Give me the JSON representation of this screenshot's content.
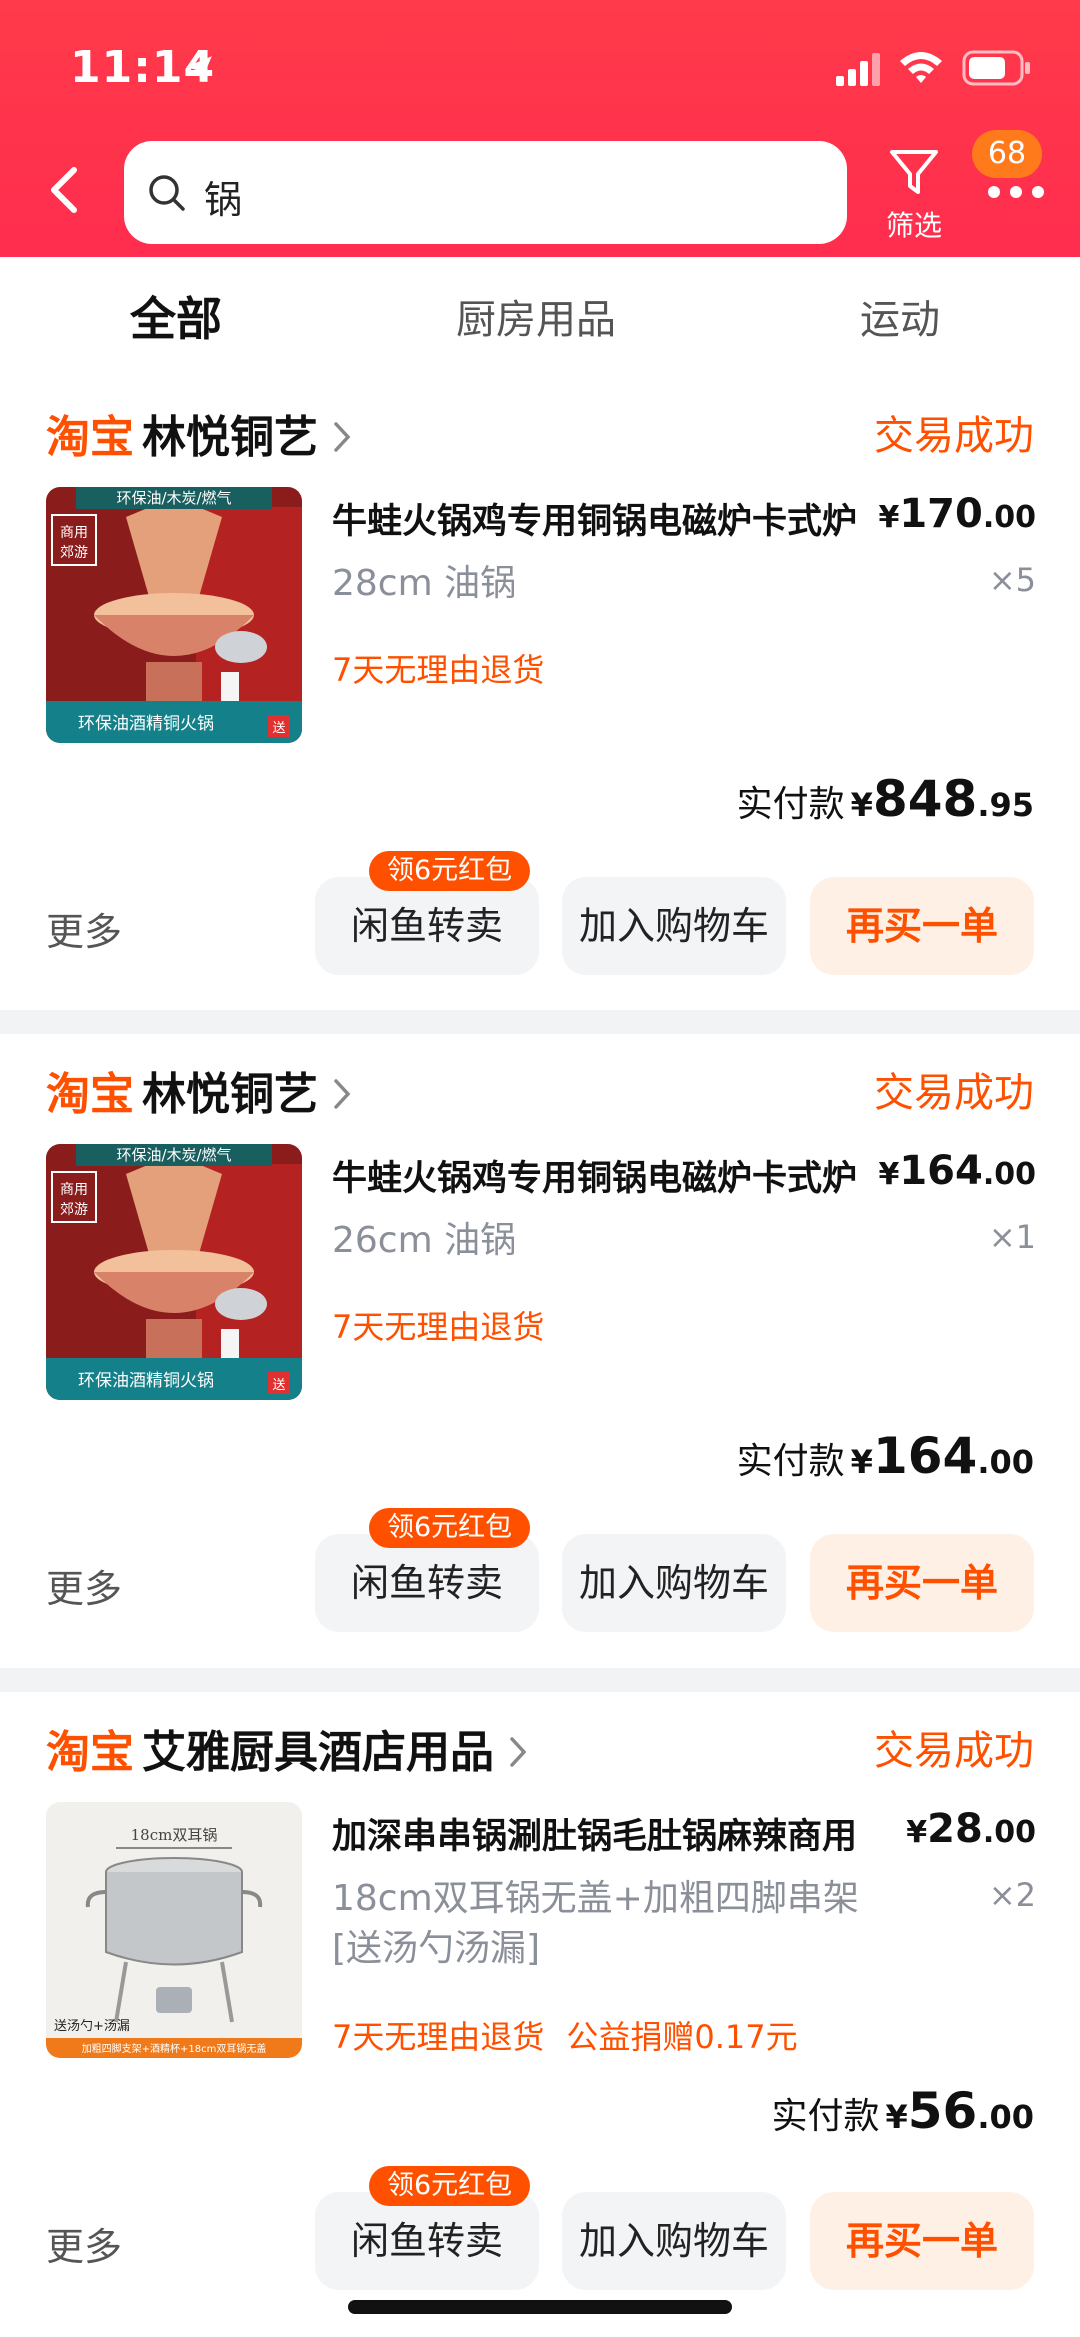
{
  "status_bar": {
    "time": "11:14"
  },
  "search": {
    "query": "锅"
  },
  "header": {
    "filter_label": "筛选",
    "more_badge": "68"
  },
  "tabs": [
    {
      "label": "全部",
      "active": true
    },
    {
      "label": "厨房用品",
      "active": false
    },
    {
      "label": "运动",
      "active": false
    }
  ],
  "orders": [
    {
      "platform": "淘宝",
      "shop": "林悦铜艺",
      "status": "交易成功",
      "title": "牛蛙火锅鸡专用铜锅电磁炉卡式炉",
      "price_yen": "¥",
      "price_int": "170",
      "price_dec": ".00",
      "sku": "28cm 油锅",
      "sku2": "",
      "qty": "×5",
      "tags": [
        "7天无理由退货"
      ],
      "paid_label": "实付款",
      "paid_yen": "¥",
      "paid_int": "848",
      "paid_dec": ".95",
      "more": "更多",
      "coupon": "领6元红包",
      "btn_resell": "闲鱼转卖",
      "btn_cart": "加入购物车",
      "btn_rebuy": "再买一单",
      "thumb": {
        "top_banner": "环保油/木炭/燃气",
        "badge": "商用\n郊游",
        "bottom_banner": "环保油酒精铜火锅",
        "gift": "送"
      }
    },
    {
      "platform": "淘宝",
      "shop": "林悦铜艺",
      "status": "交易成功",
      "title": "牛蛙火锅鸡专用铜锅电磁炉卡式炉",
      "price_yen": "¥",
      "price_int": "164",
      "price_dec": ".00",
      "sku": "26cm 油锅",
      "sku2": "",
      "qty": "×1",
      "tags": [
        "7天无理由退货"
      ],
      "paid_label": "实付款",
      "paid_yen": "¥",
      "paid_int": "164",
      "paid_dec": ".00",
      "more": "更多",
      "coupon": "领6元红包",
      "btn_resell": "闲鱼转卖",
      "btn_cart": "加入购物车",
      "btn_rebuy": "再买一单",
      "thumb": {
        "top_banner": "环保油/木炭/燃气",
        "badge": "商用\n郊游",
        "bottom_banner": "环保油酒精铜火锅",
        "gift": "送"
      }
    },
    {
      "platform": "淘宝",
      "shop": "艾雅厨具酒店用品",
      "status": "交易成功",
      "title": "加深串串锅涮肚锅毛肚锅麻辣商用",
      "price_yen": "¥",
      "price_int": "28",
      "price_dec": ".00",
      "sku": "18cm双耳锅无盖+加粗四脚串架",
      "sku2": "[送汤勺汤漏]",
      "qty": "×2",
      "tags": [
        "7天无理由退货",
        "公益捐赠0.17元"
      ],
      "paid_label": "实付款",
      "paid_yen": "¥",
      "paid_int": "56",
      "paid_dec": ".00",
      "more": "更多",
      "coupon": "领6元红包",
      "btn_resell": "闲鱼转卖",
      "btn_cart": "加入购物车",
      "btn_rebuy": "再买一单",
      "thumb": {
        "top_label": "18cm双耳锅",
        "bottom_label": "送汤勺+汤漏",
        "bottom_banner": "加粗四脚支架+酒精杯+18cm双耳锅无盖"
      }
    }
  ]
}
